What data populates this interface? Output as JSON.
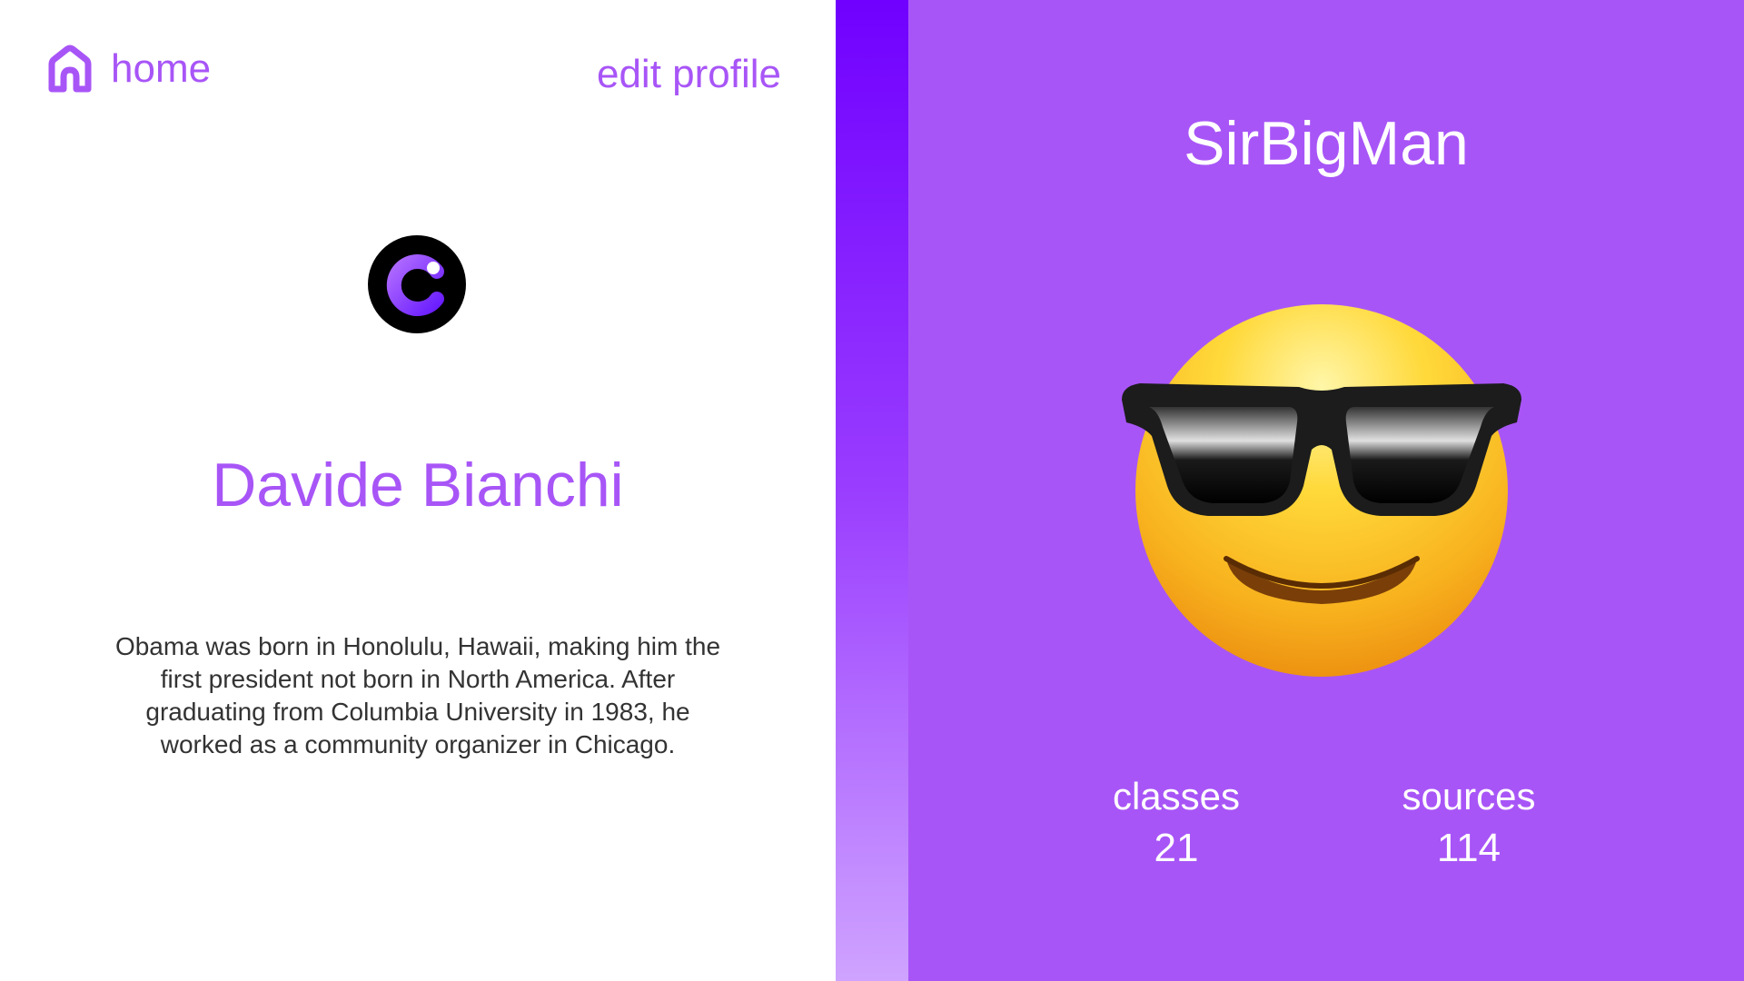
{
  "nav": {
    "home_label": "home",
    "edit_label": "edit profile"
  },
  "profile": {
    "full_name": "Davide Bianchi",
    "bio": "Obama was born in Honolulu, Hawaii, making him the first president not born in North America. After graduating from Columbia University in 1983, he worked as a community organizer in Chicago.",
    "username": "SirBigMan",
    "avatar_icon": "smiling-face-with-sunglasses-icon",
    "logo_icon": "brand-logo-icon"
  },
  "stats": {
    "classes_label": "classes",
    "classes_value": "21",
    "sources_label": "sources",
    "sources_value": "114"
  },
  "colors": {
    "accent": "#a855f7",
    "stripe_top": "#7000ff",
    "stripe_bottom": "#cfa3ff",
    "text": "#333333"
  }
}
